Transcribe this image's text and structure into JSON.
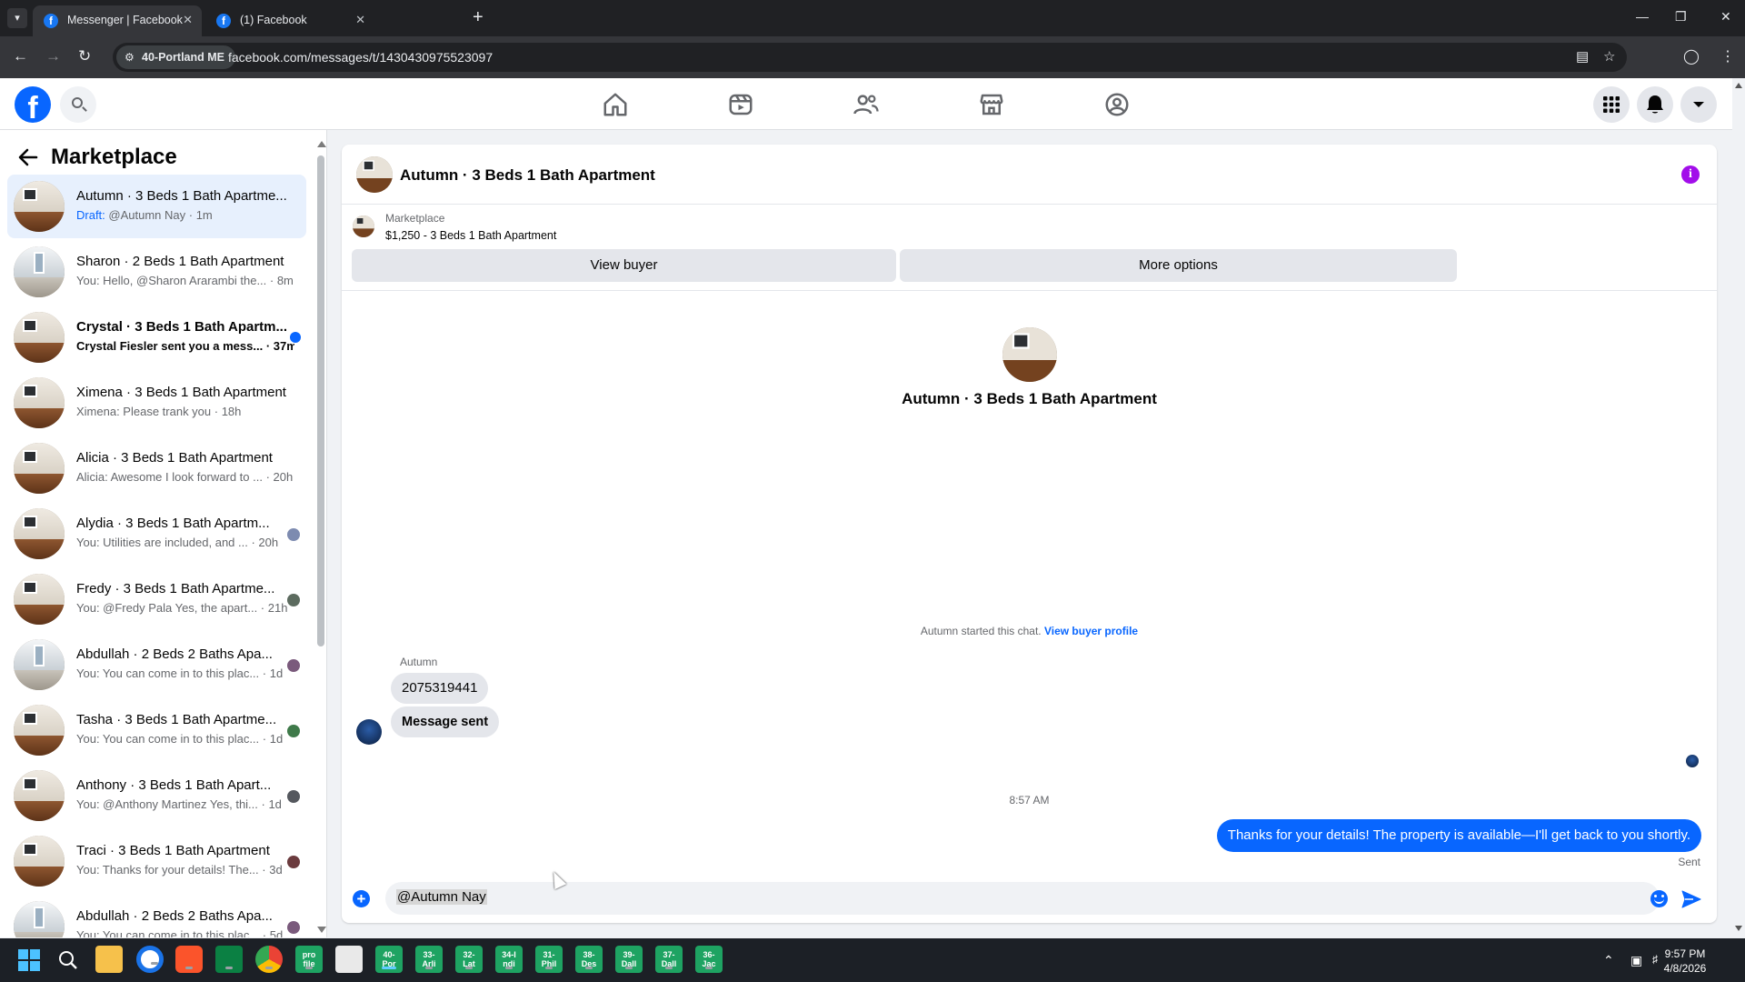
{
  "browser": {
    "tabs": [
      {
        "title": "Messenger | Facebook",
        "active": true
      },
      {
        "title": "(1) Facebook",
        "active": false
      }
    ],
    "profile_chip": "40-Portland ME",
    "url": "facebook.com/messages/t/1430430975523097"
  },
  "sidebar": {
    "title": "Marketplace",
    "conversations": [
      {
        "name": "Autumn · 3 Beds 1 Bath Apartme...",
        "draft_label": "Draft:",
        "snippet": " @Autumn Nay · 1m",
        "active": true
      },
      {
        "name": "Sharon · 2 Beds 1 Bath Apartment",
        "snippet": "You: Hello, @Sharon Ararambi the... · 8m"
      },
      {
        "name": "Crystal · 3 Beds 1 Bath Apartm...",
        "snippet": "Crystal Fiesler sent you a mess... · 37m",
        "unread": true
      },
      {
        "name": "Ximena · 3 Beds 1 Bath Apartment",
        "snippet": "Ximena: Please trank you · 18h"
      },
      {
        "name": "Alicia · 3 Beds 1 Bath Apartment",
        "snippet": "Alicia: Awesome I look forward to ... · 20h"
      },
      {
        "name": "Alydia · 3 Beds 1 Bath Apartm...",
        "snippet": "You: Utilities are included, and ... · 20h"
      },
      {
        "name": "Fredy · 3 Beds 1 Bath Apartme...",
        "snippet": "You: @Fredy Pala Yes, the apart... · 21h"
      },
      {
        "name": "Abdullah · 2 Beds 2 Baths Apa...",
        "snippet": "You: You can come in to this plac... · 1d"
      },
      {
        "name": "Tasha · 3 Beds 1 Bath Apartme...",
        "snippet": "You: You can come in to this plac... · 1d"
      },
      {
        "name": "Anthony · 3 Beds 1 Bath Apart...",
        "snippet": "You: @Anthony Martinez Yes, thi... · 1d"
      },
      {
        "name": "Traci · 3 Beds 1 Bath Apartment",
        "snippet": "You: Thanks for your details! The... · 3d"
      },
      {
        "name": "Abdullah · 2 Beds 2 Baths Apa...",
        "snippet": "You: You can come in to this plac... · 5d"
      }
    ]
  },
  "chat": {
    "title": "Autumn · 3 Beds 1 Bath Apartment",
    "listing_label": "Marketplace",
    "listing_price": "$1,250 - 3 Beds 1 Bath Apartment",
    "view_buyer": "View buyer",
    "more_options": "More options",
    "center_name": "Autumn · 3 Beds 1 Bath Apartment",
    "started_text": "Autumn started this chat. ",
    "view_profile": "View buyer profile",
    "sender": "Autumn",
    "incoming": [
      "2075319441",
      "Message sent"
    ],
    "time": "8:57 AM",
    "outgoing": "Thanks for your details! The property is available—I'll get back to you shortly.",
    "status": "Sent",
    "composer_value": "@Autumn Nay"
  },
  "taskbar": {
    "green_apps": [
      "40-\nPor",
      "33-\nArli",
      "32-\nLat",
      "34-I\nndi",
      "31-\nPhil",
      "38-\nDes",
      "39-\nDall",
      "37-\nDall",
      "36-\nJac"
    ],
    "time": "9:57 PM",
    "date": "4/8/2026"
  },
  "colors": {
    "accent": "#0866ff",
    "info": "#a20eea"
  }
}
